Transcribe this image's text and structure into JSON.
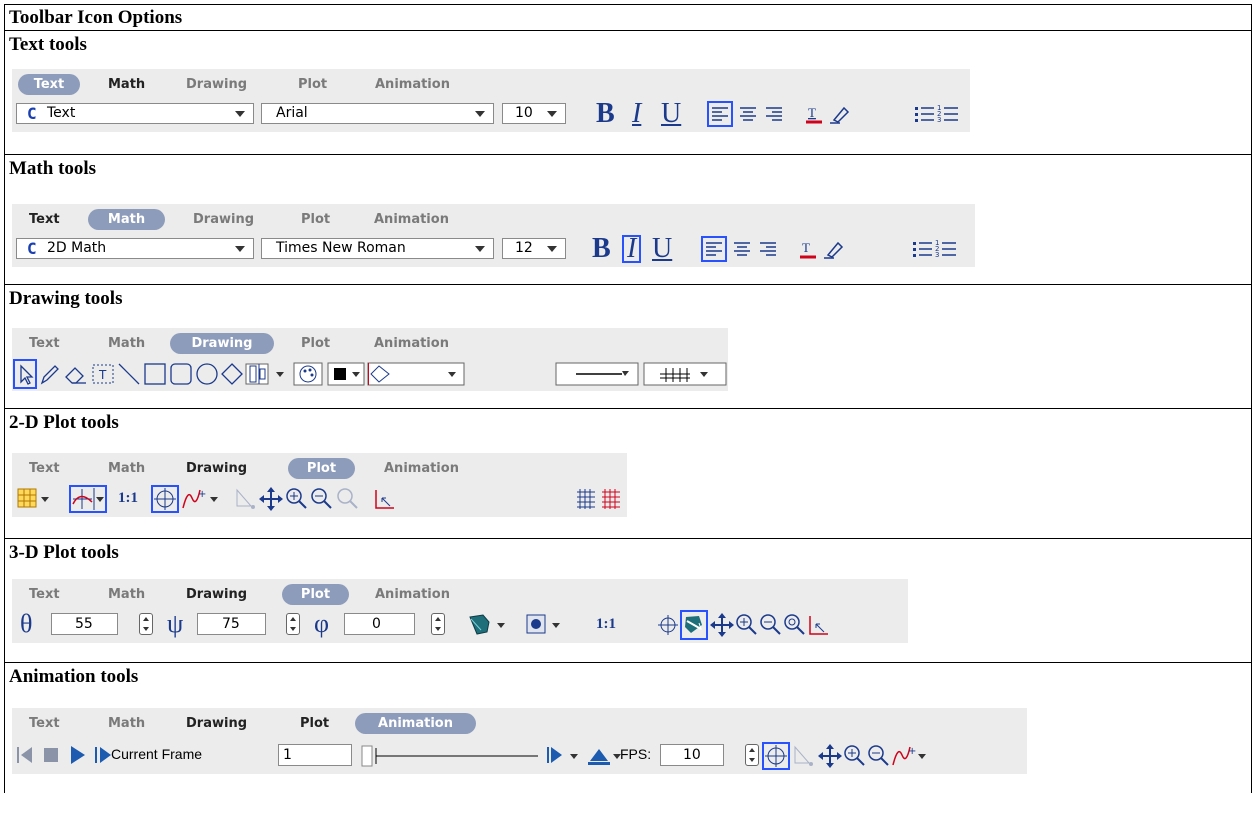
{
  "header": {
    "title": "Toolbar Icon Options"
  },
  "tab_labels": [
    "Text",
    "Math",
    "Drawing",
    "Plot",
    "Animation"
  ],
  "sections": {
    "text": {
      "title": "Text tools",
      "style_value": "Text",
      "font_value": "Arial",
      "size_value": "10"
    },
    "math": {
      "title": "Math tools",
      "style_value": "2D Math",
      "font_value": "Times New Roman",
      "size_value": "12"
    },
    "drawing": {
      "title": "Drawing tools"
    },
    "plot2d": {
      "title": "2-D Plot tools",
      "ratio_label": "1:1"
    },
    "plot3d": {
      "title": "3-D Plot tools",
      "theta_symbol": "θ",
      "theta_value": "55",
      "psi_symbol": "ψ",
      "psi_value": "75",
      "phi_symbol": "φ",
      "phi_value": "0",
      "ratio_label": "1:1"
    },
    "animation": {
      "title": "Animation tools",
      "current_frame_label": "Current Frame",
      "current_frame_value": "1",
      "fps_label": "FPS:",
      "fps_value": "10"
    }
  },
  "format_glyphs": {
    "bold": "B",
    "italic": "I",
    "underline": "U",
    "style_prefix": "C"
  },
  "colors": {
    "active_tab": "#8e9cbb",
    "toolbar_bg": "#ececec",
    "icon_blue": "#1c3a8c",
    "accent_red": "#d0021b",
    "select_blue": "#2952ff"
  }
}
